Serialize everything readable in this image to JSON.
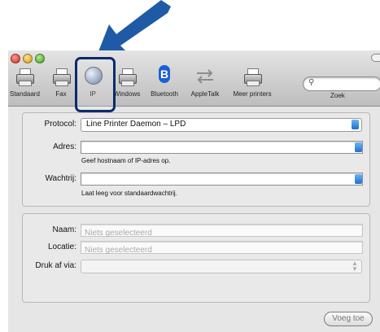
{
  "toolbar": {
    "items": [
      {
        "label": "Standaard",
        "icon": "printer-icon"
      },
      {
        "label": "Fax",
        "icon": "fax-printer-icon"
      },
      {
        "label": "IP",
        "icon": "ip-globe-icon"
      },
      {
        "label": "Windows",
        "icon": "windows-printer-icon"
      },
      {
        "label": "Bluetooth",
        "icon": "bluetooth-icon"
      },
      {
        "label": "AppleTalk",
        "icon": "appletalk-arrows-icon"
      },
      {
        "label": "Meer printers",
        "icon": "printer-icon"
      }
    ],
    "search_label": "Zoek",
    "search_placeholder": "",
    "bluetooth_glyph": "B"
  },
  "form": {
    "protocol_label": "Protocol:",
    "protocol_value": "Line Printer Daemon – LPD",
    "adres_label": "Adres:",
    "adres_value": "",
    "adres_help": "Geef hostnaam of IP-adres op.",
    "wachtrij_label": "Wachtrij:",
    "wachtrij_value": "",
    "wachtrij_help": "Laat leeg voor standaardwachtrij."
  },
  "details": {
    "naam_label": "Naam:",
    "naam_placeholder": "Niets geselecteerd",
    "locatie_label": "Locatie:",
    "locatie_placeholder": "Niets geselecteerd",
    "druk_label": "Druk af via:",
    "druk_value": ""
  },
  "add_button": "Voeg toe",
  "colors": {
    "arrow": "#1f5aa6",
    "highlight": "#0a2a6b",
    "accent": "#1f6fd0"
  }
}
